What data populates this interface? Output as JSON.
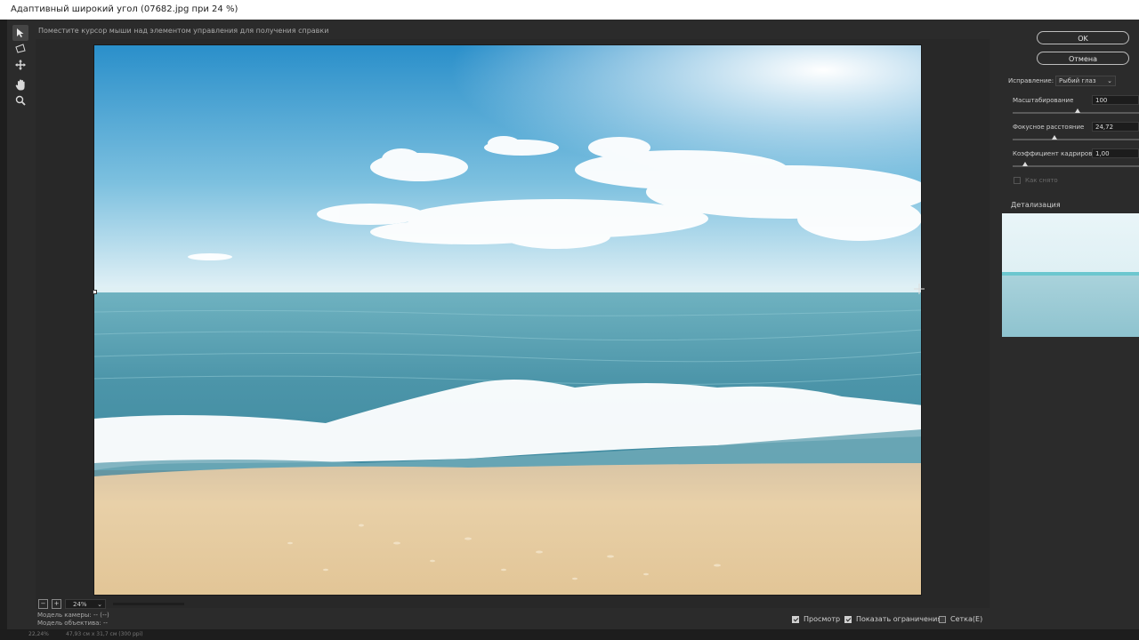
{
  "window": {
    "title": "Адаптивный широкий угол (07682.jpg при 24 %)"
  },
  "hint": "Поместите курсор мыши над элементом управления для получения справки",
  "toolbar": {
    "tools": [
      "constraint-tool",
      "polygon-constraint-tool",
      "move-tool",
      "hand-tool",
      "zoom-tool"
    ]
  },
  "buttons": {
    "ok": "OK",
    "cancel": "Отмена"
  },
  "correction": {
    "label": "Исправление:",
    "value": "Рыбий глаз"
  },
  "params": {
    "scale": {
      "label": "Масштабирование",
      "value": "100",
      "fraction": 0.5
    },
    "focal": {
      "label": "Фокусное расстояние",
      "value": "24,72",
      "fraction": 0.33
    },
    "crop": {
      "label": "Коэффициент кадрирования",
      "value": "1,00",
      "fraction": 0.1
    },
    "as_shot": {
      "label": "Как снято",
      "checked": false
    }
  },
  "detail": {
    "label": "Детализация"
  },
  "zoom": {
    "value": "24%"
  },
  "model": {
    "camera": "Модель камеры: -- (--)",
    "lens": "Модель объектива: --"
  },
  "bottom_options": {
    "preview": {
      "label": "Просмотр",
      "checked": true
    },
    "show_constraints": {
      "label": "Показать ограничения",
      "checked": true
    },
    "grid": {
      "label": "Сетка(E)",
      "checked": false
    }
  },
  "status": {
    "zoom": "22,24%",
    "size": "47,93 см x 31,7 см (300 ppi)"
  },
  "colors": {
    "sky_top": "#2a8fca",
    "sky_bottom": "#e8f4f8",
    "sea": "#4f96a8",
    "sand": "#e4cba2"
  }
}
